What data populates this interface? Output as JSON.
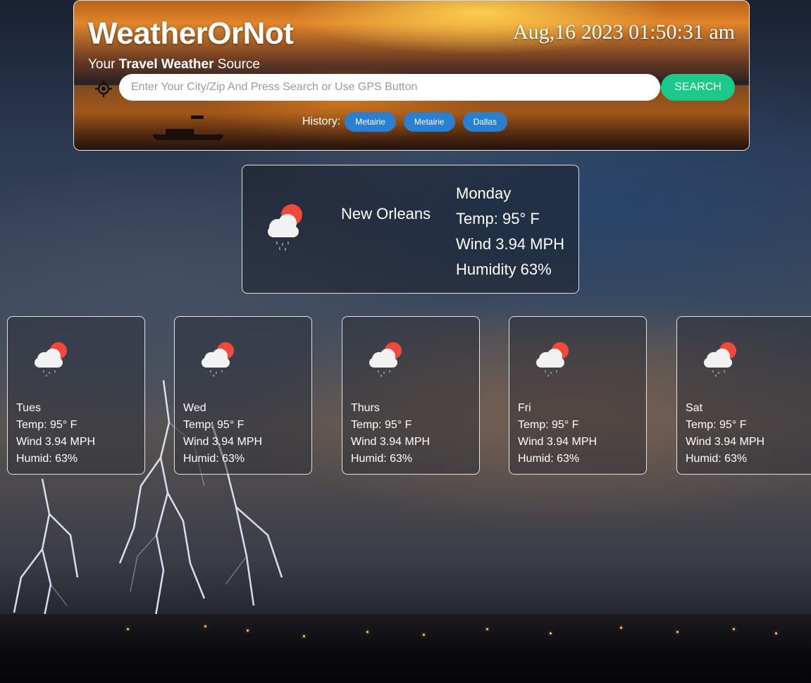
{
  "header": {
    "app_title": "WeatherOrNot",
    "tagline_prefix": "Your ",
    "tagline_bold": "Travel Weather",
    "tagline_suffix": " Source",
    "clock": "Aug,16 2023 01:50:31 am",
    "gps_icon": "gps-crosshair-icon",
    "search": {
      "placeholder": "Enter Your City/Zip And Press Search or Use GPS Button",
      "value": "",
      "button_label": "SEARCH"
    },
    "history": {
      "label": "History:",
      "items": [
        "Metairie",
        "Metairie",
        "Dallas"
      ]
    }
  },
  "current": {
    "icon": "cloud-sun-rain-icon",
    "city": "New Orleans",
    "day": "Monday",
    "temp": "Temp: 95° F",
    "wind": "Wind 3.94 MPH",
    "humidity": "Humidity 63%"
  },
  "forecast": [
    {
      "icon": "cloud-sun-rain-icon",
      "day": "Tues",
      "temp": "Temp: 95° F",
      "wind": "Wind 3.94 MPH",
      "humid": "Humid: 63%"
    },
    {
      "icon": "cloud-sun-rain-icon",
      "day": "Wed",
      "temp": "Temp: 95° F",
      "wind": "Wind 3.94 MPH",
      "humid": "Humid: 63%"
    },
    {
      "icon": "cloud-sun-rain-icon",
      "day": "Thurs",
      "temp": "Temp: 95° F",
      "wind": "Wind 3.94 MPH",
      "humid": "Humid: 63%"
    },
    {
      "icon": "cloud-sun-rain-icon",
      "day": "Fri",
      "temp": "Temp: 95° F",
      "wind": "Wind 3.94 MPH",
      "humid": "Humid: 63%"
    },
    {
      "icon": "cloud-sun-rain-icon",
      "day": "Sat",
      "temp": "Temp: 95° F",
      "wind": "Wind 3.94 MPH",
      "humid": "Humid: 63%"
    }
  ],
  "colors": {
    "search_button": "#1cc88a",
    "history_chip": "#2a7fd0",
    "card_border": "#ffffff",
    "sun": "#ef4a3c"
  }
}
